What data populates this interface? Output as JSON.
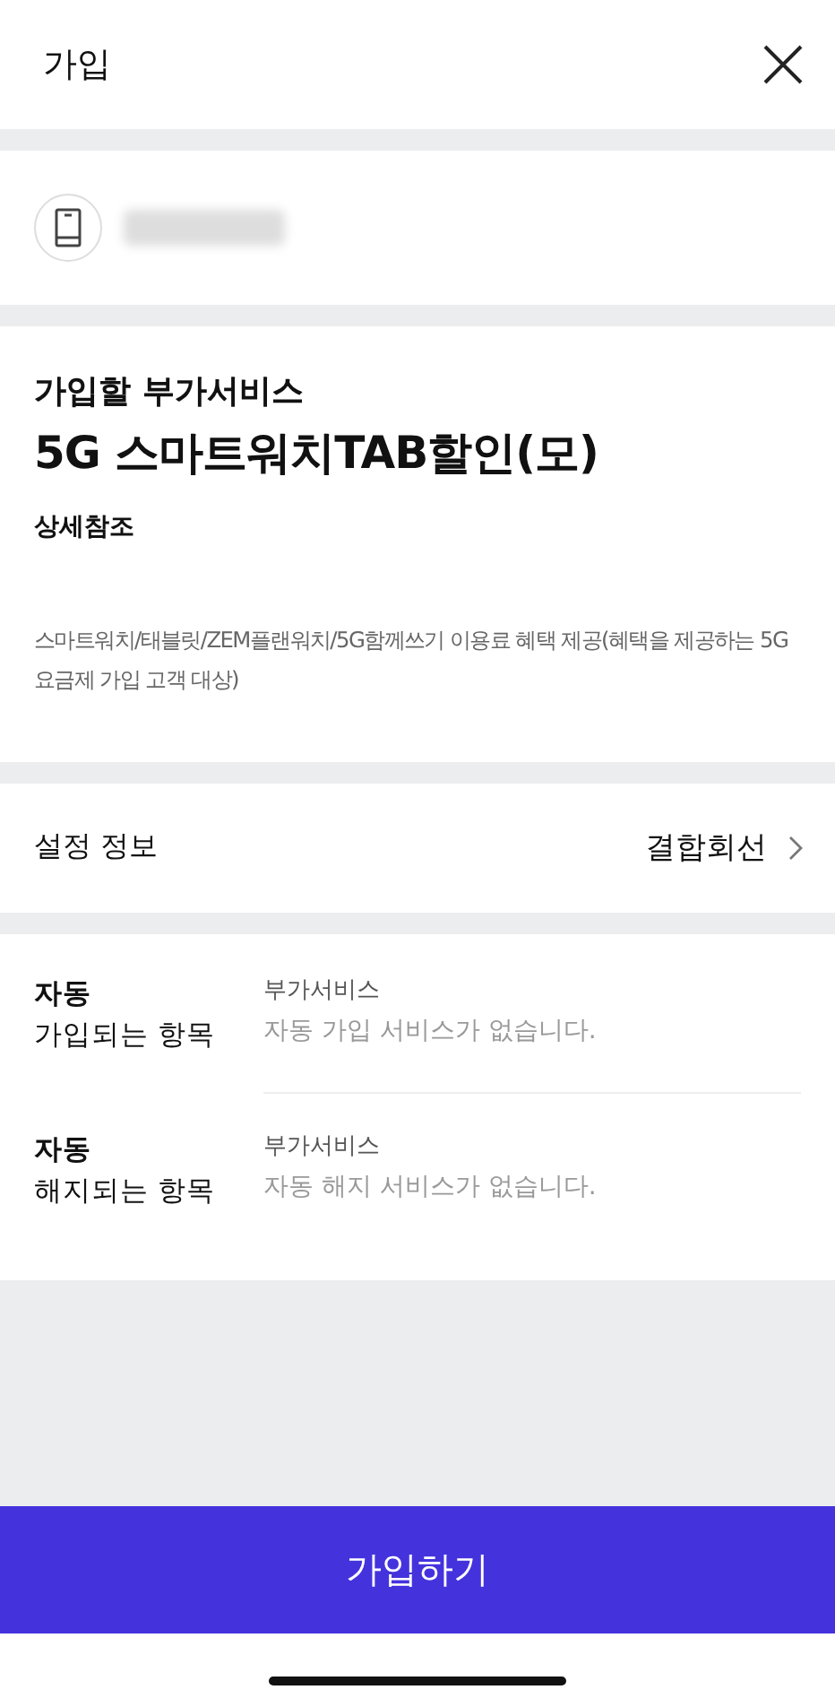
{
  "header": {
    "title": "가입"
  },
  "service": {
    "label": "가입할 부가서비스",
    "name": "5G 스마트워치TAB할인(모)",
    "detail_link": "상세참조",
    "description": "스마트워치/태블릿/ZEM플랜워치/5G함께쓰기 이용료 혜택 제공(혜택을 제공하는 5G 요금제 가입 고객 대상)"
  },
  "settings": {
    "label": "설정 정보",
    "value": "결합회선"
  },
  "auto_items": [
    {
      "title_bold": "자동",
      "title": "가입되는 항목",
      "category": "부가서비스",
      "message": "자동 가입 서비스가 없습니다."
    },
    {
      "title_bold": "자동",
      "title": "해지되는 항목",
      "category": "부가서비스",
      "message": "자동 해지 서비스가 없습니다."
    }
  ],
  "submit_button": "가입하기"
}
